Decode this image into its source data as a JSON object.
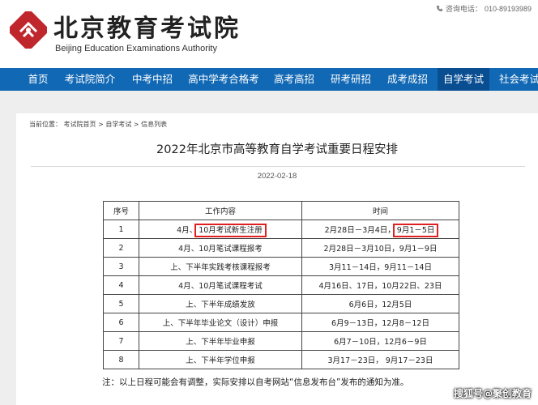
{
  "header": {
    "logo_cn": "北京教育考试院",
    "logo_en": "Beijing Education Examinations Authority",
    "hotline_label": "咨询电话：",
    "hotline_number": "010-89193989"
  },
  "nav": {
    "items": [
      "首页",
      "考试院简介",
      "中考中招",
      "高中学考合格考",
      "高考高招",
      "研考研招",
      "成考成招",
      "自学考试",
      "社会考试"
    ],
    "active": "自学考试"
  },
  "breadcrumb": {
    "prefix": "当前位置：",
    "items": [
      "考试院首页",
      "自学考试",
      "信息列表"
    ],
    "separator": ">"
  },
  "article": {
    "title": "2022年北京市高等教育自学考试重要日程安排",
    "date": "2022-02-18"
  },
  "table": {
    "headers": [
      "序号",
      "工作内容",
      "时间"
    ],
    "rows": [
      [
        "1",
        "4月、10月考试新生注册",
        "2月28日－3月4日，9月1－5日"
      ],
      [
        "2",
        "4月、10月笔试课程报考",
        "2月28日－3月10日，9月1－9日"
      ],
      [
        "3",
        "上、下半年实践考核课程报考",
        "3月11－14日，9月11－14日"
      ],
      [
        "4",
        "4月、10月笔试课程考试",
        "4月16日、17日，10月22日、23日"
      ],
      [
        "5",
        "上、下半年成绩发放",
        "6月6日，12月5日"
      ],
      [
        "6",
        "上、下半年毕业论文（设计）申报",
        "6月9－13日，12月8－12日"
      ],
      [
        "7",
        "上、下半年毕业申报",
        "6月7－10日，12月6－9日"
      ],
      [
        "8",
        "上、下半年学位申报",
        "3月17－23日， 9月17－23日"
      ]
    ],
    "row1_content_prefix": "4月、",
    "row1_content_highlight": "10月考试新生注册",
    "row1_time_prefix": "2月28日－3月4日，",
    "row1_time_highlight": "9月1－5日"
  },
  "note": "注：以上日程可能会有调整，实际安排以自考网站“信息发布台”发布的通知为准。",
  "watermark": "搜狐号@聚创教育",
  "colors": {
    "nav_bg": "#1168b4",
    "nav_active": "#0a4e92",
    "highlight": "#e02020",
    "logo_red": "#c0272d"
  }
}
